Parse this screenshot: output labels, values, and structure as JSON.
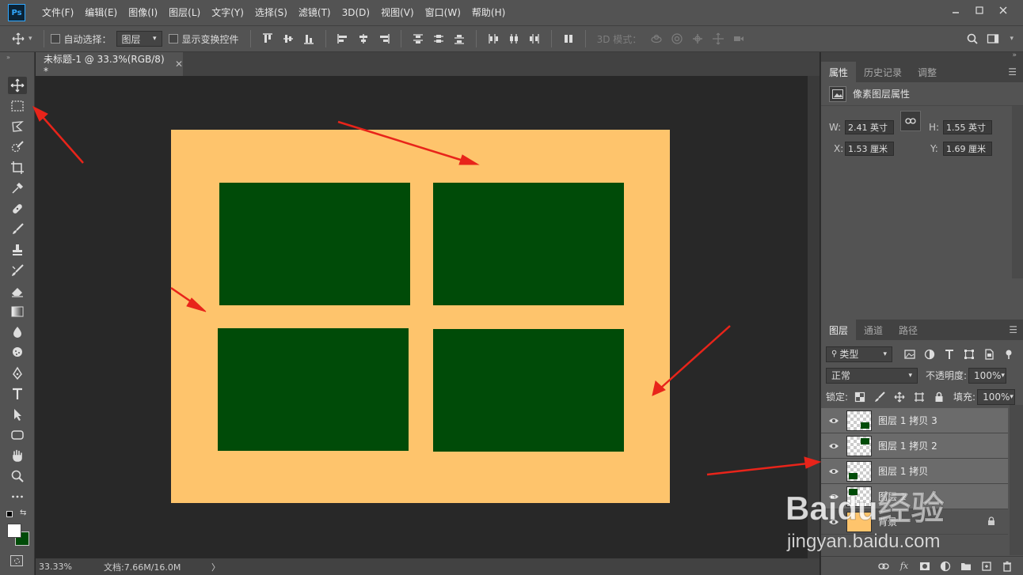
{
  "menu": {
    "logo": "Ps",
    "items": [
      "文件(F)",
      "编辑(E)",
      "图像(I)",
      "图层(L)",
      "文字(Y)",
      "选择(S)",
      "滤镜(T)",
      "3D(D)",
      "视图(V)",
      "窗口(W)",
      "帮助(H)"
    ]
  },
  "options": {
    "auto_select_label": "自动选择：",
    "auto_select_value": "图层",
    "show_transform_label": "显示变换控件",
    "mode_3d_label": "3D 模式："
  },
  "document": {
    "tab_title": "未标题-1 @ 33.3%(RGB/8) *",
    "background_color": "#fec46c",
    "rect_color": "#004b08"
  },
  "status": {
    "zoom": "33.33%",
    "doc_info": "文档:7.66M/16.0M",
    "arrow": "〉"
  },
  "properties": {
    "tabs": [
      "属性",
      "历史记录",
      "调整"
    ],
    "header": "像素图层属性",
    "w_label": "W:",
    "w_value": "2.41 英寸",
    "h_label": "H:",
    "h_value": "1.55 英寸",
    "x_label": "X:",
    "x_value": "1.53 厘米",
    "y_label": "Y:",
    "y_value": "1.69 厘米"
  },
  "layers": {
    "tabs": [
      "图层",
      "通道",
      "路径"
    ],
    "filter_value": "类型",
    "blend_mode": "正常",
    "opacity_label": "不透明度:",
    "opacity_value": "100%",
    "lock_label": "锁定:",
    "fill_label": "填充:",
    "fill_value": "100%",
    "items": [
      {
        "name": "图层 1 拷贝 3"
      },
      {
        "name": "图层 1 拷贝 2"
      },
      {
        "name": "图层 1 拷贝"
      },
      {
        "name": "图层 1"
      },
      {
        "name": "背景"
      }
    ]
  },
  "watermark": {
    "brand": "Baidu经验",
    "url": "jingyan.baidu.com"
  },
  "colors": {
    "foreground": "#ffffff",
    "background": "#004b08",
    "annotation_arrow": "#e8241a"
  }
}
